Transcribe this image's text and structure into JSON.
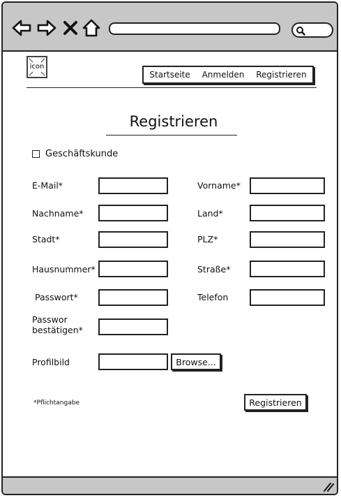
{
  "toolbar": {
    "back_icon": "back-arrow-icon",
    "forward_icon": "forward-arrow-icon",
    "close_icon": "close-icon",
    "home_icon": "home-icon",
    "url": "",
    "search_icon": "search-icon"
  },
  "header": {
    "logo_label": "icon",
    "nav": [
      "Startseite",
      "Anmelden",
      "Registrieren"
    ]
  },
  "page": {
    "title": "Registrieren",
    "business_checkbox": {
      "label": "Geschäftskunde",
      "checked": false
    }
  },
  "form": {
    "email_label": "E-Mail*",
    "vorname_label": "Vorname*",
    "nachname_label": "Nachname*",
    "land_label": "Land*",
    "stadt_label": "Stadt*",
    "plz_label": "PLZ*",
    "hausnummer_label": "Hausnummer*",
    "strasse_label": "Straße*",
    "passwort_label": "Passwort*",
    "telefon_label": "Telefon",
    "passwort_confirm_label_line1": "Passwor",
    "passwort_confirm_label_line2": "bestätigen*",
    "profilbild_label": "Profilbild",
    "browse_button": "Browse...",
    "required_note": "*Pflichtangabe",
    "submit_button": "Registrieren"
  },
  "colors": {
    "chrome_gray": "#c7c7c7",
    "outline": "#222222"
  }
}
